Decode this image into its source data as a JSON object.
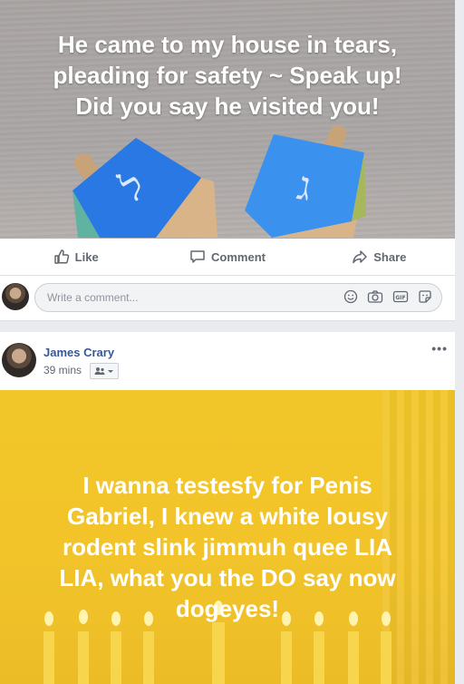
{
  "post1": {
    "banner_lines": [
      "He came to my house in tears,",
      "pleading for safety ~ Speak up!",
      "Did you say he visited you!"
    ],
    "actions": {
      "like": "Like",
      "comment": "Comment",
      "share": "Share"
    },
    "comment_placeholder": "Write a comment...",
    "input_icons": [
      "emoji-icon",
      "camera-icon",
      "gif-icon",
      "sticker-icon"
    ]
  },
  "post2": {
    "author": "James Crary",
    "time": "39 mins",
    "audience_icon": "friends-icon",
    "more": "•••",
    "banner_lines": [
      "I wanna testesfy for Penis",
      "Gabriel, I knew a white lousy",
      "rodent slink jimmuh quee LIA",
      "LIA, what you the DO say now",
      "dogeyes!"
    ]
  },
  "colors": {
    "link_blue": "#365899",
    "gray_text": "#606770",
    "banner1_bg": "#aaa6a5",
    "banner2_bg": "#f1c628",
    "dreidel_blue": "#2f7fe8"
  }
}
